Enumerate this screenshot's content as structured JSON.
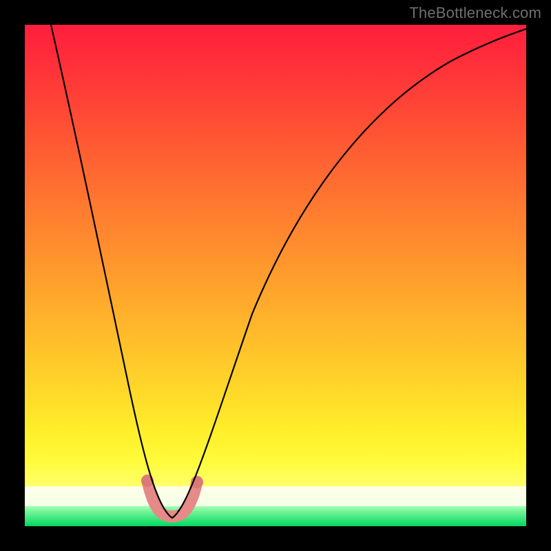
{
  "watermark": "TheBottleneck.com",
  "chart_data": {
    "type": "line",
    "title": "",
    "xlabel": "",
    "ylabel": "",
    "xlim": [
      0,
      100
    ],
    "ylim": [
      0,
      100
    ],
    "background_gradient": {
      "direction": "vertical",
      "stops": [
        {
          "pos": 0,
          "color": "#ff1e3c"
        },
        {
          "pos": 50,
          "color": "#ff9a2d"
        },
        {
          "pos": 85,
          "color": "#ffee2a"
        },
        {
          "pos": 93,
          "color": "#ffffd8"
        },
        {
          "pos": 100,
          "color": "#00d85c"
        }
      ]
    },
    "series": [
      {
        "name": "bottleneck-curve",
        "color": "#000000",
        "x": [
          5,
          10,
          14,
          18,
          21,
          24,
          26,
          27.5,
          29,
          31,
          34,
          38,
          44,
          52,
          62,
          72,
          82,
          92,
          100
        ],
        "y": [
          100,
          82,
          66,
          50,
          36,
          22,
          12,
          4,
          2,
          4,
          13,
          27,
          44,
          60,
          73,
          82,
          88,
          93,
          96
        ]
      },
      {
        "name": "optimal-region",
        "color": "#e58a86",
        "x": [
          24.5,
          26,
          27.5,
          29,
          30.5,
          32,
          33.5
        ],
        "y": [
          9,
          4,
          2,
          1.5,
          2,
          4,
          8
        ]
      }
    ],
    "markers": [
      {
        "series": "optimal-region",
        "x": 24.5,
        "y": 9
      },
      {
        "series": "optimal-region",
        "x": 33.5,
        "y": 8
      }
    ]
  }
}
